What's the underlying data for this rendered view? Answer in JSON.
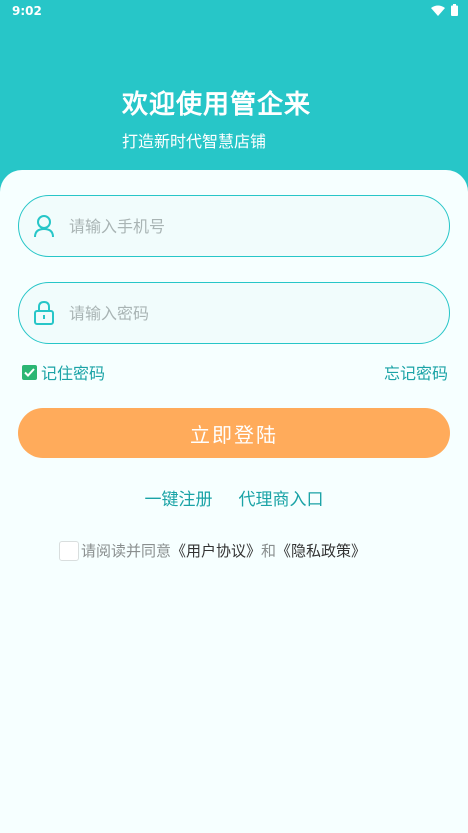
{
  "status_bar": {
    "time": "9:02"
  },
  "header": {
    "title": "欢迎使用管企来",
    "subtitle": "打造新时代智慧店铺"
  },
  "form": {
    "phone_placeholder": "请输入手机号",
    "password_placeholder": "请输入密码",
    "remember_label": "记住密码",
    "forgot_label": "忘记密码",
    "login_label": "立即登陆"
  },
  "links": {
    "register": "一键注册",
    "agent": "代理商入口"
  },
  "agreement": {
    "prefix": "请阅读并同意",
    "user_agreement": "《用户协议》",
    "and": "和",
    "privacy": "《隐私政策》"
  },
  "colors": {
    "primary": "#27c6c8",
    "accent": "#ffab5b",
    "link": "#1aa3a6",
    "check": "#2bb673"
  }
}
